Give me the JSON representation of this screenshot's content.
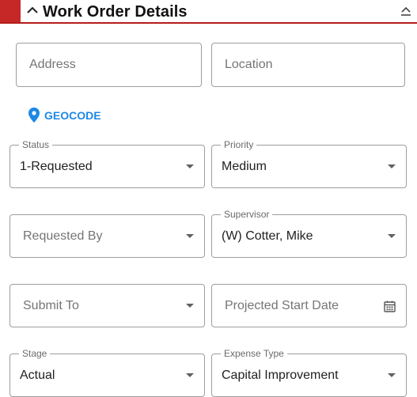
{
  "header": {
    "title": "Work Order Details"
  },
  "address": {
    "placeholder": "Address"
  },
  "location": {
    "placeholder": "Location"
  },
  "geocode": {
    "label": "GEOCODE"
  },
  "status": {
    "label": "Status",
    "value": "1-Requested"
  },
  "priority": {
    "label": "Priority",
    "value": "Medium"
  },
  "requested_by": {
    "placeholder": "Requested By"
  },
  "supervisor": {
    "label": "Supervisor",
    "value": "(W) Cotter, Mike"
  },
  "submit_to": {
    "placeholder": "Submit To"
  },
  "projected_start": {
    "placeholder": "Projected Start Date"
  },
  "stage": {
    "label": "Stage",
    "value": "Actual"
  },
  "expense_type": {
    "label": "Expense Type",
    "value": "Capital Improvement"
  },
  "colors": {
    "accent": "#c62828",
    "link": "#1e88e5",
    "border": "#9e9e9e"
  }
}
